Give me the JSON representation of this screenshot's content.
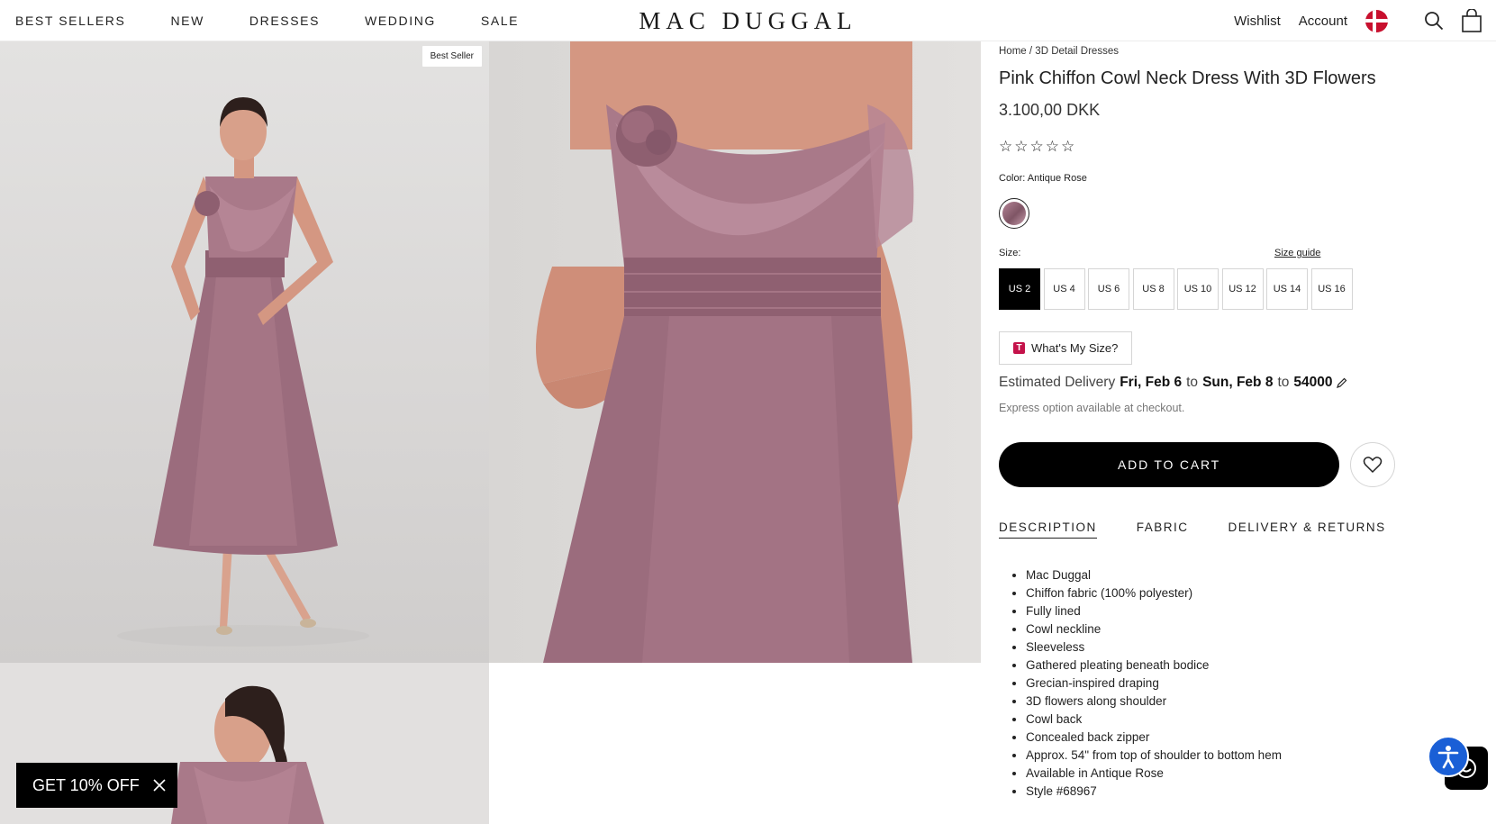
{
  "header": {
    "nav": [
      "BEST SELLERS",
      "NEW",
      "DRESSES",
      "WEDDING",
      "SALE"
    ],
    "logo": "MAC DUGGAL",
    "wishlist": "Wishlist",
    "account": "Account",
    "flag_icon": "denmark-flag-icon",
    "search_icon": "search-icon",
    "cart_icon": "shopping-bag-icon"
  },
  "gallery": {
    "badge": "Best Seller",
    "dress_color": "#9e6f80"
  },
  "product": {
    "breadcrumb": [
      "Home",
      "/",
      "3D Detail Dresses"
    ],
    "title": "Pink Chiffon Cowl Neck Dress With 3D Flowers",
    "price": "3.100,00 DKK",
    "rating_stars": [
      "☆",
      "☆",
      "☆",
      "☆",
      "☆"
    ],
    "color_label": "Color: Antique Rose",
    "size_label": "Size:",
    "size_guide": "Size guide",
    "sizes": [
      "US 2",
      "US 4",
      "US 6",
      "US 8",
      "US 10",
      "US 12",
      "US 14",
      "US 16"
    ],
    "selected_size": "US 2",
    "whats_my_size": "What's My Size?",
    "whats_my_size_logo": "T",
    "delivery": {
      "prefix": "Estimated Delivery",
      "from": "Fri, Feb 6",
      "to_word": "to",
      "until": "Sun, Feb 8",
      "zip_word": "to",
      "zip": "54000"
    },
    "express_note": "Express option available at checkout.",
    "add_to_cart": "ADD TO CART",
    "tabs": [
      "DESCRIPTION",
      "FABRIC",
      "DELIVERY & RETURNS"
    ],
    "active_tab": "DESCRIPTION",
    "description": [
      "Mac Duggal",
      "Chiffon fabric (100% polyester)",
      "Fully lined",
      "Cowl neckline",
      "Sleeveless",
      "Gathered pleating beneath bodice",
      "Grecian-inspired draping",
      "3D flowers along shoulder",
      "Cowl back",
      "Concealed back zipper",
      "Approx. 54\" from top of shoulder to bottom hem",
      "Available in Antique Rose",
      "Style #68967"
    ]
  },
  "promo": {
    "label": "GET 10% OFF"
  },
  "colors": {
    "accessibility_blue": "#1a5fd6",
    "button_black": "#000000",
    "accent_magenta": "#c4124a"
  }
}
